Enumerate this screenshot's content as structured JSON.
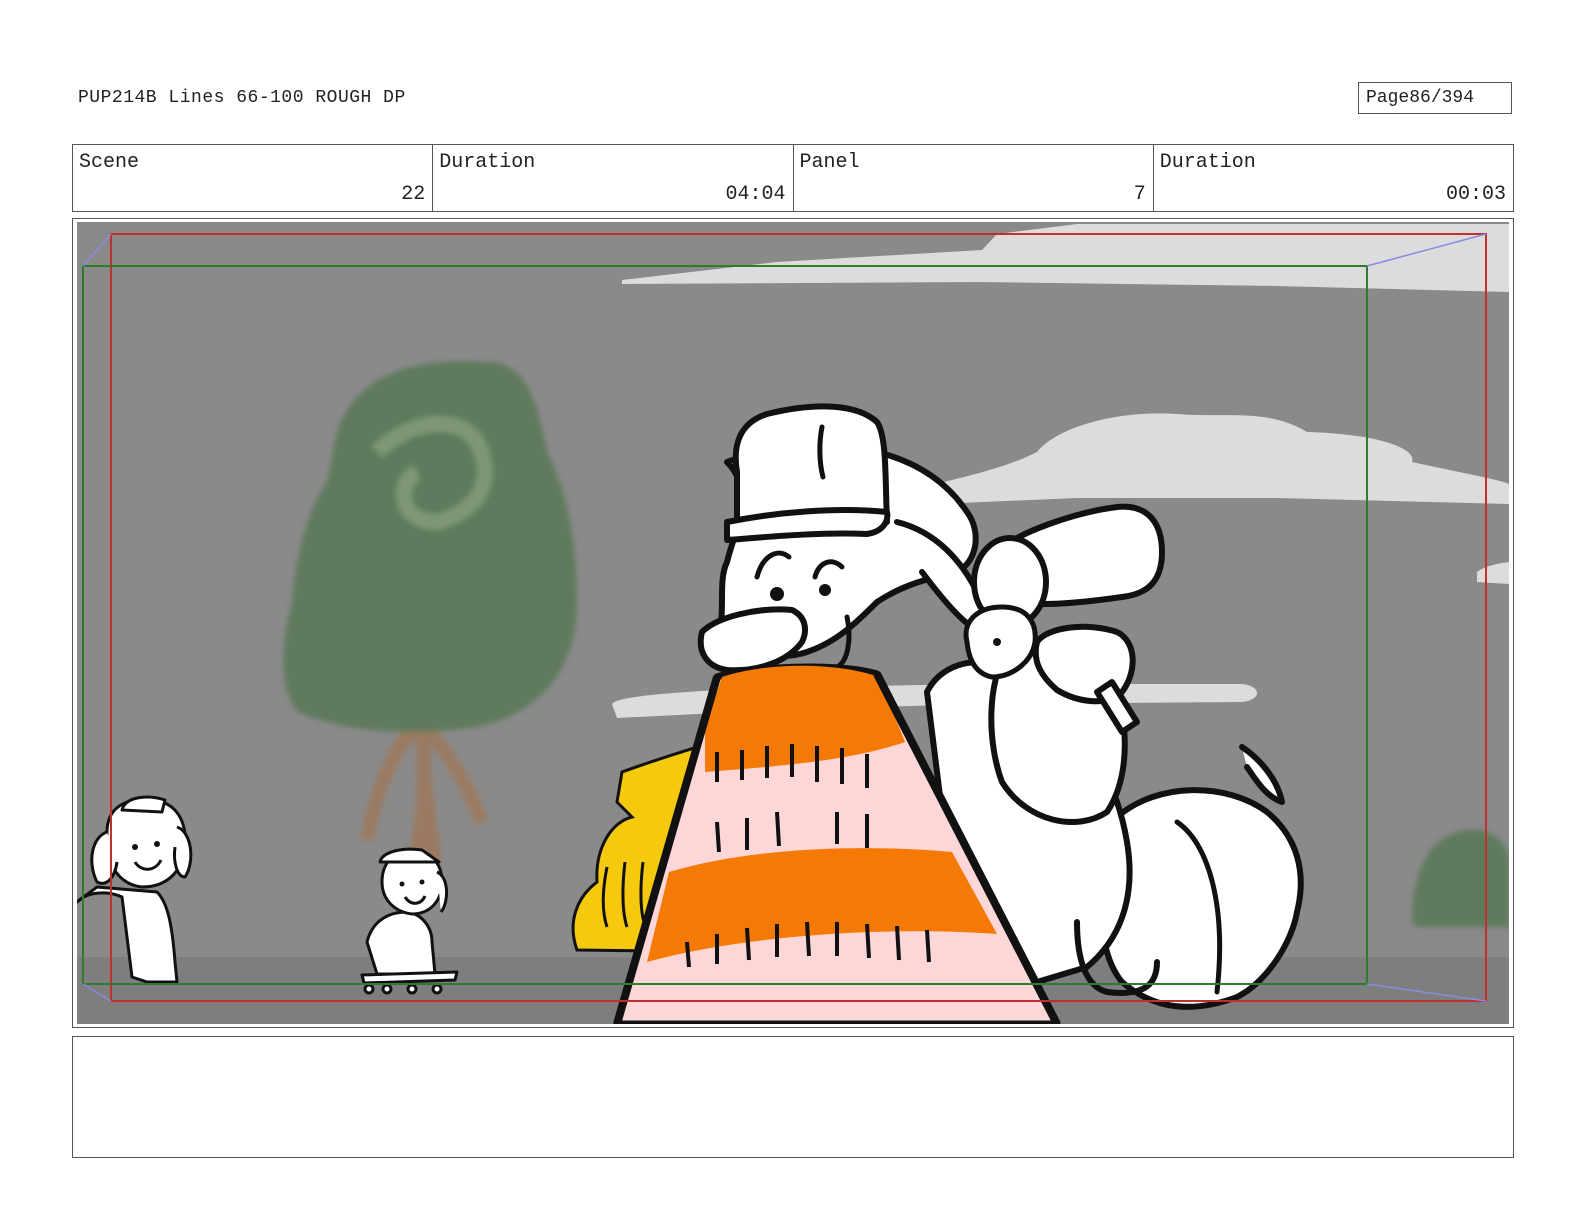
{
  "header": {
    "title": "PUP214B Lines 66-100 ROUGH DP",
    "page_label": "Page",
    "page_number": "86/394"
  },
  "info": {
    "scene_label": "Scene",
    "scene_value": "22",
    "scene_duration_label": "Duration",
    "scene_duration_value": "04:04",
    "panel_label": "Panel",
    "panel_value": "7",
    "panel_duration_label": "Duration",
    "panel_duration_value": "00:03"
  },
  "colors": {
    "sky": "#8a8a8a",
    "cloud": "#dcdcdc",
    "tree_green": "#5f7a5c",
    "trunk": "#9a7a62",
    "cone_orange": "#f57a05",
    "cone_pink": "#fdd7d7",
    "car_yellow": "#f4c90e",
    "safe_frame_red": "#c03030",
    "action_frame_green": "#2e7d2e",
    "camera_guide_blue": "#8a8ae0"
  },
  "notes": ""
}
